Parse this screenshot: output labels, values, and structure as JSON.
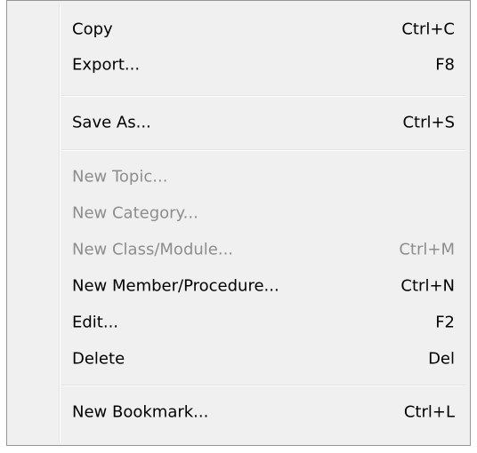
{
  "menu": {
    "items": [
      {
        "label": "Copy",
        "shortcut": "Ctrl+C",
        "enabled": true
      },
      {
        "label": "Export...",
        "shortcut": "F8",
        "enabled": true
      },
      {
        "label": "Save As...",
        "shortcut": "Ctrl+S",
        "enabled": true
      },
      {
        "label": "New Topic...",
        "shortcut": "",
        "enabled": false
      },
      {
        "label": "New Category...",
        "shortcut": "",
        "enabled": false
      },
      {
        "label": "New Class/Module...",
        "shortcut": "Ctrl+M",
        "enabled": false
      },
      {
        "label": "New Member/Procedure...",
        "shortcut": "Ctrl+N",
        "enabled": true
      },
      {
        "label": "Edit...",
        "shortcut": "F2",
        "enabled": true
      },
      {
        "label": "Delete",
        "shortcut": "Del",
        "enabled": true
      },
      {
        "label": "New Bookmark...",
        "shortcut": "Ctrl+L",
        "enabled": true
      }
    ]
  }
}
